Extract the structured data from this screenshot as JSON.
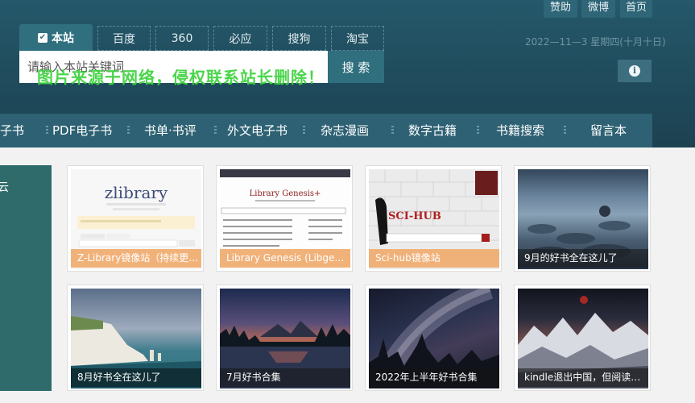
{
  "top_links": [
    "赞助",
    "微博",
    "首页"
  ],
  "date": "2022—11—3 星期四(十月十日)",
  "search": {
    "site_tab": "本站",
    "engines": [
      "百度",
      "360",
      "必应",
      "搜狗",
      "淘宝"
    ],
    "placeholder": "请输入本站关键词",
    "button": "搜 索"
  },
  "watermark": "图片来源于网络，侵权联系站长删除！",
  "nav": [
    "电子书",
    "PDF电子书",
    "书单·书评",
    "外文电子书",
    "杂志漫画",
    "数字古籍",
    "书籍搜索",
    "留言本"
  ],
  "left_panel_label": "云",
  "cards": [
    {
      "caption": "Z-Library镜像站（持续更新）",
      "thumb_text": "zlibrary"
    },
    {
      "caption": "Library Genesis (Libgen) 镜像站",
      "thumb_text": "Library Genesis+"
    },
    {
      "caption": "Sci-hub镜像站",
      "thumb_text": "SCI-HUB"
    },
    {
      "caption": "9月的好书全在这儿了"
    },
    {
      "caption": "8月好书全在这儿了"
    },
    {
      "caption": "7月好书合集"
    },
    {
      "caption": "2022年上半年好书合集"
    },
    {
      "caption": "kindle退出中国，但阅读永远都在"
    }
  ]
}
